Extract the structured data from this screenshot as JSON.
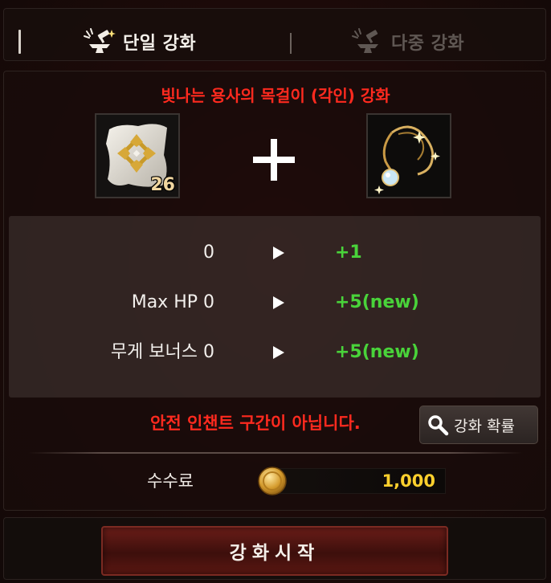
{
  "tabs": {
    "single": {
      "label": "단일 강화",
      "icon": "anvil-hammer-icon"
    },
    "multi": {
      "label": "다중 강화",
      "icon": "anvil-hammer-icon"
    }
  },
  "item": {
    "title": "빛나는 용사의 목걸이 (각인) 강화",
    "material": {
      "icon": "enhancement-scroll-icon",
      "count": "26"
    },
    "combine_icon": "plus-icon",
    "target": {
      "icon": "necklace-icon"
    }
  },
  "stats": [
    {
      "label": "0",
      "new_value": "+1"
    },
    {
      "label": "Max HP 0",
      "new_value": "+5(new)"
    },
    {
      "label": "무게 보너스 0",
      "new_value": "+5(new)"
    }
  ],
  "warning": "안전 인챈트 구간이 아닙니다.",
  "rate_button": {
    "label": "강화 확률",
    "icon": "search-icon"
  },
  "fee": {
    "label": "수수료",
    "value": "1,000",
    "icon": "gold-coin-icon"
  },
  "start_button": {
    "label": "강화시작"
  },
  "colors": {
    "warning": "#ff2a1f",
    "stat_new": "#49d33a",
    "fee_value": "#ffd02d"
  }
}
